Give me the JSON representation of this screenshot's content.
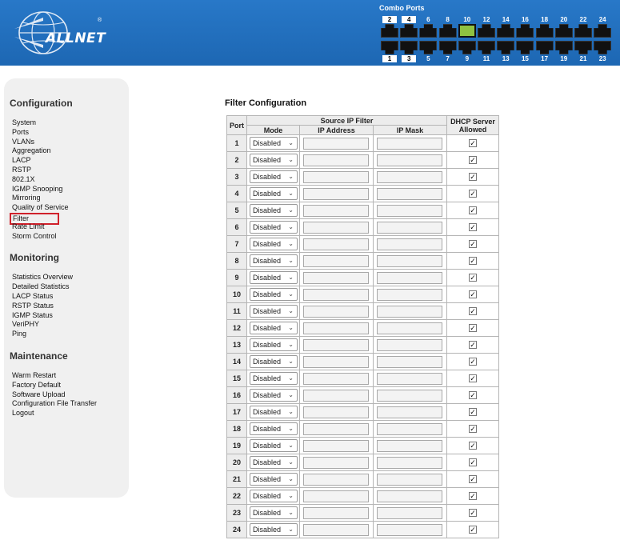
{
  "brand": {
    "logo_text": "ALLNET",
    "reg_mark": "®"
  },
  "combo_ports_label": "Combo Ports",
  "switch_ports": {
    "top_labels": [
      "2",
      "4",
      "6",
      "8",
      "10",
      "12",
      "14",
      "16",
      "18",
      "20",
      "22",
      "24"
    ],
    "bottom_labels": [
      "1",
      "3",
      "5",
      "7",
      "9",
      "11",
      "13",
      "15",
      "17",
      "19",
      "21",
      "23"
    ],
    "active_port": "10"
  },
  "sidebar": {
    "sections": [
      {
        "heading": "Configuration",
        "items": [
          "System",
          "Ports",
          "VLANs",
          "Aggregation",
          "LACP",
          "RSTP",
          "802.1X",
          "IGMP Snooping",
          "Mirroring",
          "Quality of Service",
          "Filter",
          "Rate Limit",
          "Storm Control"
        ]
      },
      {
        "heading": "Monitoring",
        "items": [
          "Statistics Overview",
          "Detailed Statistics",
          "LACP Status",
          "RSTP Status",
          "IGMP Status",
          "VeriPHY",
          "Ping"
        ]
      },
      {
        "heading": "Maintenance",
        "items": [
          "Warm Restart",
          "Factory Default",
          "Software Upload",
          "Configuration File Transfer",
          "Logout"
        ]
      }
    ],
    "active_item": "Filter"
  },
  "main": {
    "title": "Filter Configuration",
    "table": {
      "headers": {
        "port": "Port",
        "source_ip_filter": "Source IP Filter",
        "mode": "Mode",
        "ip_address": "IP Address",
        "ip_mask": "IP Mask",
        "dhcp_line1": "DHCP Server",
        "dhcp_line2": "Allowed"
      },
      "rows": [
        {
          "port": "1",
          "mode": "Disabled",
          "ip": "",
          "mask": "",
          "dhcp": true
        },
        {
          "port": "2",
          "mode": "Disabled",
          "ip": "",
          "mask": "",
          "dhcp": true
        },
        {
          "port": "3",
          "mode": "Disabled",
          "ip": "",
          "mask": "",
          "dhcp": true
        },
        {
          "port": "4",
          "mode": "Disabled",
          "ip": "",
          "mask": "",
          "dhcp": true
        },
        {
          "port": "5",
          "mode": "Disabled",
          "ip": "",
          "mask": "",
          "dhcp": true
        },
        {
          "port": "6",
          "mode": "Disabled",
          "ip": "",
          "mask": "",
          "dhcp": true
        },
        {
          "port": "7",
          "mode": "Disabled",
          "ip": "",
          "mask": "",
          "dhcp": true
        },
        {
          "port": "8",
          "mode": "Disabled",
          "ip": "",
          "mask": "",
          "dhcp": true
        },
        {
          "port": "9",
          "mode": "Disabled",
          "ip": "",
          "mask": "",
          "dhcp": true
        },
        {
          "port": "10",
          "mode": "Disabled",
          "ip": "",
          "mask": "",
          "dhcp": true
        },
        {
          "port": "11",
          "mode": "Disabled",
          "ip": "",
          "mask": "",
          "dhcp": true
        },
        {
          "port": "12",
          "mode": "Disabled",
          "ip": "",
          "mask": "",
          "dhcp": true
        },
        {
          "port": "13",
          "mode": "Disabled",
          "ip": "",
          "mask": "",
          "dhcp": true
        },
        {
          "port": "14",
          "mode": "Disabled",
          "ip": "",
          "mask": "",
          "dhcp": true
        },
        {
          "port": "15",
          "mode": "Disabled",
          "ip": "",
          "mask": "",
          "dhcp": true
        },
        {
          "port": "16",
          "mode": "Disabled",
          "ip": "",
          "mask": "",
          "dhcp": true
        },
        {
          "port": "17",
          "mode": "Disabled",
          "ip": "",
          "mask": "",
          "dhcp": true
        },
        {
          "port": "18",
          "mode": "Disabled",
          "ip": "",
          "mask": "",
          "dhcp": true
        },
        {
          "port": "19",
          "mode": "Disabled",
          "ip": "",
          "mask": "",
          "dhcp": true
        },
        {
          "port": "20",
          "mode": "Disabled",
          "ip": "",
          "mask": "",
          "dhcp": true
        },
        {
          "port": "21",
          "mode": "Disabled",
          "ip": "",
          "mask": "",
          "dhcp": true
        },
        {
          "port": "22",
          "mode": "Disabled",
          "ip": "",
          "mask": "",
          "dhcp": true
        },
        {
          "port": "23",
          "mode": "Disabled",
          "ip": "",
          "mask": "",
          "dhcp": true
        },
        {
          "port": "24",
          "mode": "Disabled",
          "ip": "",
          "mask": "",
          "dhcp": true
        }
      ]
    }
  },
  "colors": {
    "header_bg": "#1f6dbb",
    "active_outline": "#d0202a",
    "port_active": "#8fc241"
  }
}
